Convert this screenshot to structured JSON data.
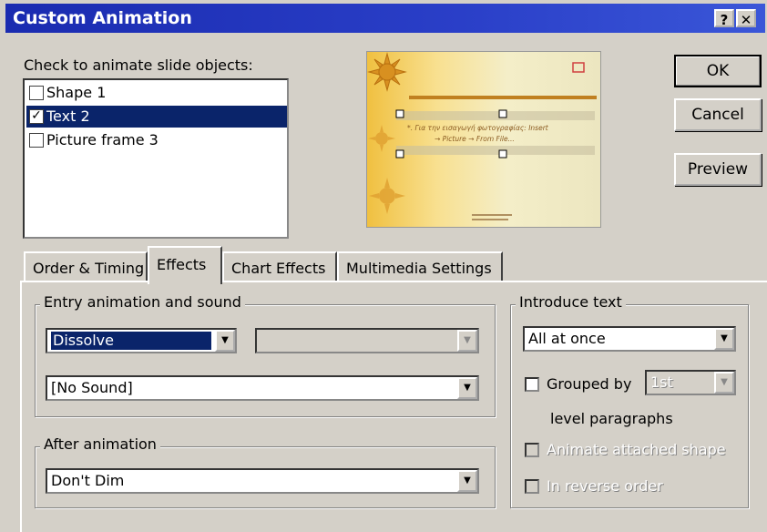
{
  "window": {
    "title": "Custom Animation",
    "help_label": "?",
    "close_label": "✕"
  },
  "objects": {
    "label": "Check to animate slide objects:",
    "items": [
      {
        "label": "Shape 1",
        "checked": false,
        "check_glyph": ""
      },
      {
        "label": "Text 2",
        "checked": true,
        "check_glyph": "✓"
      },
      {
        "label": "Picture frame 3",
        "checked": false,
        "check_glyph": ""
      }
    ]
  },
  "preview": {
    "line1": "*. Για την εισαγωγή φωτογραφίας: Insert",
    "line2": "→ Picture → From File..."
  },
  "buttons": {
    "ok": "OK",
    "cancel": "Cancel",
    "preview": "Preview"
  },
  "tabs": [
    "Order & Timing",
    "Effects",
    "Chart Effects",
    "Multimedia Settings"
  ],
  "active_tab": "Effects",
  "entry": {
    "group_label": "Entry animation and sound",
    "effect": "Dissolve",
    "direction": "",
    "sound": "[No Sound]"
  },
  "after": {
    "group_label": "After animation",
    "value": "Don't Dim"
  },
  "introduce": {
    "group_label": "Introduce text",
    "value": "All at once",
    "grouped_label": "Grouped by",
    "grouped_value": "1st",
    "level_label": "level paragraphs",
    "animate_attached": "Animate attached shape",
    "reverse": "In reverse order"
  },
  "icons": {
    "dropdown": "▼"
  }
}
